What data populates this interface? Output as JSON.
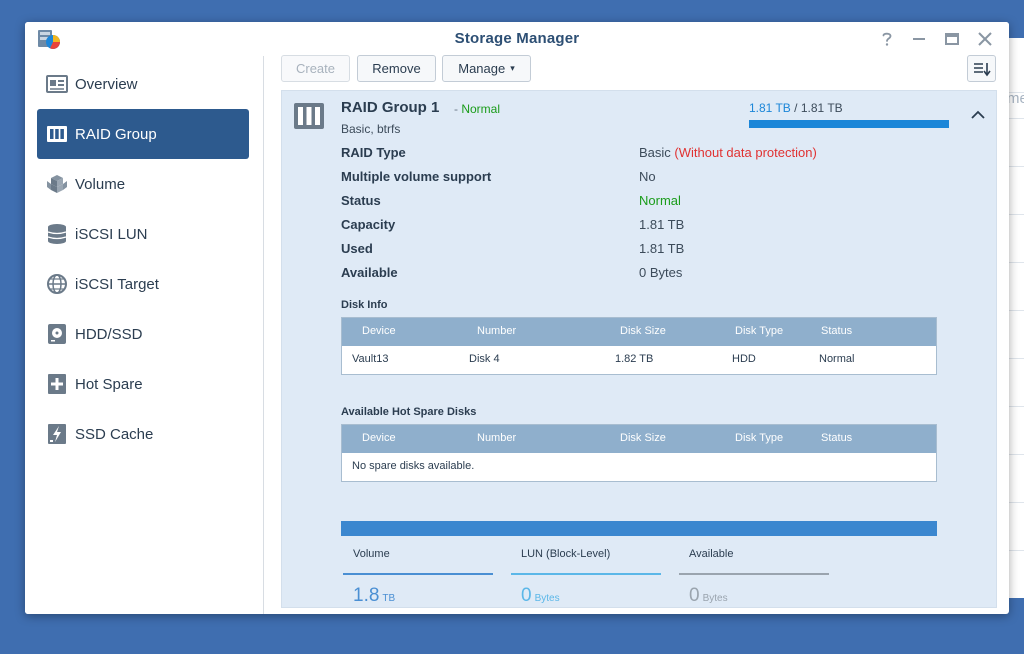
{
  "background_window": {
    "partial_text": "me"
  },
  "window": {
    "title": "Storage Manager"
  },
  "sidebar": {
    "items": [
      {
        "label": "Overview",
        "icon": "overview-icon",
        "active": false
      },
      {
        "label": "RAID Group",
        "icon": "raid-group-icon",
        "active": true
      },
      {
        "label": "Volume",
        "icon": "volume-icon",
        "active": false
      },
      {
        "label": "iSCSI LUN",
        "icon": "iscsi-lun-icon",
        "active": false
      },
      {
        "label": "iSCSI Target",
        "icon": "iscsi-target-icon",
        "active": false
      },
      {
        "label": "HDD/SSD",
        "icon": "hdd-icon",
        "active": false
      },
      {
        "label": "Hot Spare",
        "icon": "hot-spare-icon",
        "active": false
      },
      {
        "label": "SSD Cache",
        "icon": "ssd-cache-icon",
        "active": false
      }
    ]
  },
  "toolbar": {
    "create_label": "Create",
    "remove_label": "Remove",
    "manage_label": "Manage",
    "manage_caret": "▾"
  },
  "raid": {
    "title": "RAID Group 1",
    "status_sep": "-",
    "status": "Normal",
    "subtitle": "Basic, btrfs",
    "capacity_used": "1.81 TB",
    "capacity_sep": "/",
    "capacity_total": "1.81 TB",
    "capacity_fraction": 1.0,
    "properties": [
      {
        "label": "RAID Type",
        "value": "Basic",
        "note": "(Without data protection)"
      },
      {
        "label": "Multiple volume support",
        "value": "No"
      },
      {
        "label": "Status",
        "value": "Normal"
      },
      {
        "label": "Capacity",
        "value": "1.81 TB"
      },
      {
        "label": "Used",
        "value": "1.81 TB"
      },
      {
        "label": "Available",
        "value": "0 Bytes"
      }
    ]
  },
  "disk_info": {
    "title": "Disk Info",
    "columns": [
      "Device",
      "Number",
      "Disk Size",
      "Disk Type",
      "Status"
    ],
    "rows": [
      {
        "device": "Vault13",
        "number": "Disk 4",
        "size": "1.82 TB",
        "type": "HDD",
        "status": "Normal"
      }
    ]
  },
  "hot_spare": {
    "title": "Available Hot Spare Disks",
    "columns": [
      "Device",
      "Number",
      "Disk Size",
      "Disk Type",
      "Status"
    ],
    "empty_text": "No spare disks available."
  },
  "summary": [
    {
      "label": "Volume",
      "value": "1.8",
      "unit": "TB",
      "color": "#4a8fd3"
    },
    {
      "label": "LUN (Block-Level)",
      "value": "0",
      "unit": "Bytes",
      "color": "#5bb7e8"
    },
    {
      "label": "Available",
      "value": "0",
      "unit": "Bytes",
      "color": "#9aa4ae"
    }
  ],
  "colors": {
    "accent": "#2d5a8e",
    "bar": "#1b86d8",
    "ok_green": "#1a9c1a",
    "warn_red": "#e03232",
    "table_header": "#8fafcc",
    "panel": "#dfeaf6",
    "desktop": "#3f6eb0"
  }
}
